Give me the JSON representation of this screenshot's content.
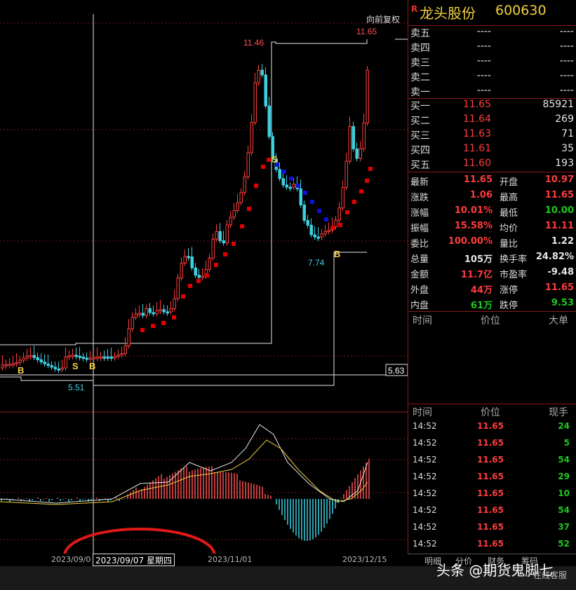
{
  "stock": {
    "r_mark": "R",
    "name": "龙头股份",
    "code": "600630"
  },
  "chart": {
    "price_labels": {
      "high": "11.46",
      "latest": "11.65",
      "low1": "5.51",
      "low2": "7.74",
      "level": "5.63"
    },
    "adjust_label": "向前复权",
    "signals": [
      "B",
      "S",
      "B",
      "S",
      "B"
    ],
    "date_ticks": [
      "2023/09/0",
      "2023/11/01",
      "2023/12/15"
    ],
    "cursor_date": "2023/09/07 星期四",
    "colors": {
      "up": "#ff3c3c",
      "down": "#3cd0e0",
      "band_up": "#e00000",
      "band_down": "#1010d0",
      "guide": "#e6e6e6"
    }
  },
  "order_book": {
    "asks": [
      {
        "label": "卖五",
        "price": "----",
        "vol": "----"
      },
      {
        "label": "卖四",
        "price": "----",
        "vol": "----"
      },
      {
        "label": "卖三",
        "price": "----",
        "vol": "----"
      },
      {
        "label": "卖二",
        "price": "----",
        "vol": "----"
      },
      {
        "label": "卖一",
        "price": "----",
        "vol": "----"
      }
    ],
    "bids": [
      {
        "label": "买一",
        "price": "11.65",
        "vol": "85921"
      },
      {
        "label": "买二",
        "price": "11.64",
        "vol": "269"
      },
      {
        "label": "买三",
        "price": "11.63",
        "vol": "71"
      },
      {
        "label": "买四",
        "price": "11.61",
        "vol": "35"
      },
      {
        "label": "买五",
        "price": "11.60",
        "vol": "193"
      }
    ]
  },
  "stats": [
    {
      "l1": "最新",
      "v1": "11.65",
      "c1": "red",
      "l2": "开盘",
      "v2": "10.97",
      "c2": "red"
    },
    {
      "l1": "涨跌",
      "v1": "1.06",
      "c1": "red",
      "l2": "最高",
      "v2": "11.65",
      "c2": "red"
    },
    {
      "l1": "涨幅",
      "v1": "10.01%",
      "c1": "red",
      "l2": "最低",
      "v2": "10.00",
      "c2": "green"
    },
    {
      "l1": "振幅",
      "v1": "15.58%",
      "c1": "red",
      "l2": "均价",
      "v2": "11.11",
      "c2": "red"
    },
    {
      "l1": "委比",
      "v1": "100.00%",
      "c1": "red",
      "l2": "量比",
      "v2": "1.22",
      "c2": "white"
    },
    {
      "l1": "总量",
      "v1": "105万",
      "c1": "white",
      "l2": "换手率",
      "v2": "24.82%",
      "c2": "white"
    },
    {
      "l1": "金额",
      "v1": "11.7亿",
      "c1": "red",
      "l2": "市盈率",
      "v2": "-9.48",
      "c2": "white"
    },
    {
      "l1": "外盘",
      "v1": "44万",
      "c1": "red",
      "l2": "涨停",
      "v2": "11.65",
      "c2": "red"
    },
    {
      "l1": "内盘",
      "v1": "61万",
      "c1": "green",
      "l2": "跌停",
      "v2": "9.53",
      "c2": "green"
    }
  ],
  "big_order": {
    "col1": "时间",
    "col2": "价位",
    "col3": "大单"
  },
  "ticks_header": {
    "col1": "时间",
    "col2": "价位",
    "col3": "现手"
  },
  "ticks": [
    {
      "time": "14:52",
      "price": "11.65",
      "vol": "24"
    },
    {
      "time": "14:52",
      "price": "11.65",
      "vol": "5"
    },
    {
      "time": "14:52",
      "price": "11.65",
      "vol": "54"
    },
    {
      "time": "14:52",
      "price": "11.65",
      "vol": "29"
    },
    {
      "time": "14:52",
      "price": "11.65",
      "vol": "10"
    },
    {
      "time": "14:52",
      "price": "11.65",
      "vol": "54"
    },
    {
      "time": "14:52",
      "price": "11.65",
      "vol": "37"
    },
    {
      "time": "14:52",
      "price": "11.65",
      "vol": "52"
    }
  ],
  "bottom_tabs": [
    "明细",
    "分价",
    "财务",
    "筹码"
  ],
  "watermark": {
    "main": "头条 @期货鬼脚七",
    "sub": "在线客服"
  }
}
